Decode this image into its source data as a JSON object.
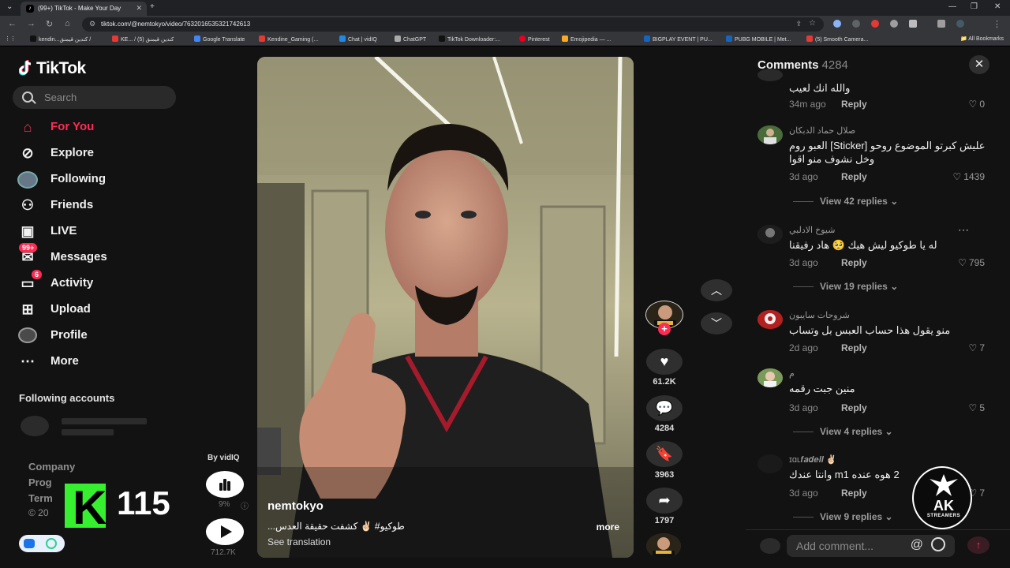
{
  "browser": {
    "tab_title": "(99+) TikTok - Make Your Day",
    "url": "tiktok.com/@nemtokyo/video/7632016535321742613",
    "bookmarks": [
      "kendin...كندين قيمنق /",
      "KE... / كندين قيمنق (5)",
      "Google Translate",
      "Kendine_Gaming (...",
      "Chat | vidIQ",
      "ChatGPT",
      "TikTok Downloader:...",
      "Pinterest",
      "Emojipedia — ...",
      "BIGPLAY EVENT | PU...",
      "PUBG MOBILE | Met...",
      "(5) Smooth Camera..."
    ],
    "all_bookmarks": "All Bookmarks"
  },
  "sidebar": {
    "logo": "TikTok",
    "search_placeholder": "Search",
    "nav": [
      {
        "label": "For You",
        "icon": "home-icon"
      },
      {
        "label": "Explore",
        "icon": "compass-icon"
      },
      {
        "label": "Following",
        "icon": "following-avatar-icon"
      },
      {
        "label": "Friends",
        "icon": "friends-icon"
      },
      {
        "label": "LIVE",
        "icon": "live-tv-icon"
      },
      {
        "label": "Messages",
        "icon": "messages-icon",
        "badge": "99+"
      },
      {
        "label": "Activity",
        "icon": "activity-icon",
        "badge": "6"
      },
      {
        "label": "Upload",
        "icon": "upload-icon"
      },
      {
        "label": "Profile",
        "icon": "profile-avatar-icon"
      },
      {
        "label": "More",
        "icon": "more-dots-icon"
      }
    ],
    "following_accounts_title": "Following accounts",
    "footer": {
      "company": "Company",
      "program": "Prog",
      "terms": "Term",
      "copyright": "© 20"
    },
    "overlay_count": "115"
  },
  "vidiq": {
    "by": "By vidIQ",
    "percent": "9%",
    "views": "712.7K"
  },
  "video": {
    "username": "nemtokyo",
    "caption": "...طوكيو# ✌🏻 كشفت حقيقة العدس",
    "more": "more",
    "see_translation": "See translation"
  },
  "actions": {
    "likes": "61.2K",
    "comments": "4284",
    "saves": "3963",
    "shares": "1797"
  },
  "comments_panel": {
    "title": "Comments",
    "count": "4284",
    "input_placeholder": "Add comment...",
    "items": [
      {
        "user": "",
        "text": "والله انك لعيب",
        "time": "34m ago",
        "reply": "Reply",
        "likes": "0",
        "view_replies": ""
      },
      {
        "user": "صلال حماد الدبكان",
        "text": "عليش كبرتو الموضوع روحو [Sticker] العبو روم وخل نشوف منو اقوا",
        "time": "3d ago",
        "reply": "Reply",
        "likes": "1439",
        "view_replies": "View 42 replies"
      },
      {
        "user": "شيوخ الادلبي",
        "text": "له يا طوكيو ليش هيك 🥺 هاد رفيقنا",
        "time": "3d ago",
        "reply": "Reply",
        "likes": "795",
        "view_replies": "View 19 replies"
      },
      {
        "user": "شروحات سايبون",
        "text": "منو يقول هذا حساب العبس بل وتساب",
        "time": "2d ago",
        "reply": "Reply",
        "likes": "7",
        "view_replies": ""
      },
      {
        "user": "م",
        "text": "منين جبت رقمه",
        "time": "3d ago",
        "reply": "Reply",
        "likes": "5",
        "view_replies": "View 4 replies"
      },
      {
        "user": "ɪɑʟ𝒇𝒂𝒅𝒆𝒍𝒍 ✌🏻",
        "text": "2 هوه عنده m1 وانتا عندك",
        "time": "3d ago",
        "reply": "Reply",
        "likes": "7",
        "view_replies": "View 9 replies"
      }
    ]
  },
  "watermark": {
    "line1": "AK",
    "line2": "STREAMERS"
  },
  "colors": {
    "accent": "#fe2c55",
    "background": "#121212",
    "kick_green": "#36f02f"
  }
}
